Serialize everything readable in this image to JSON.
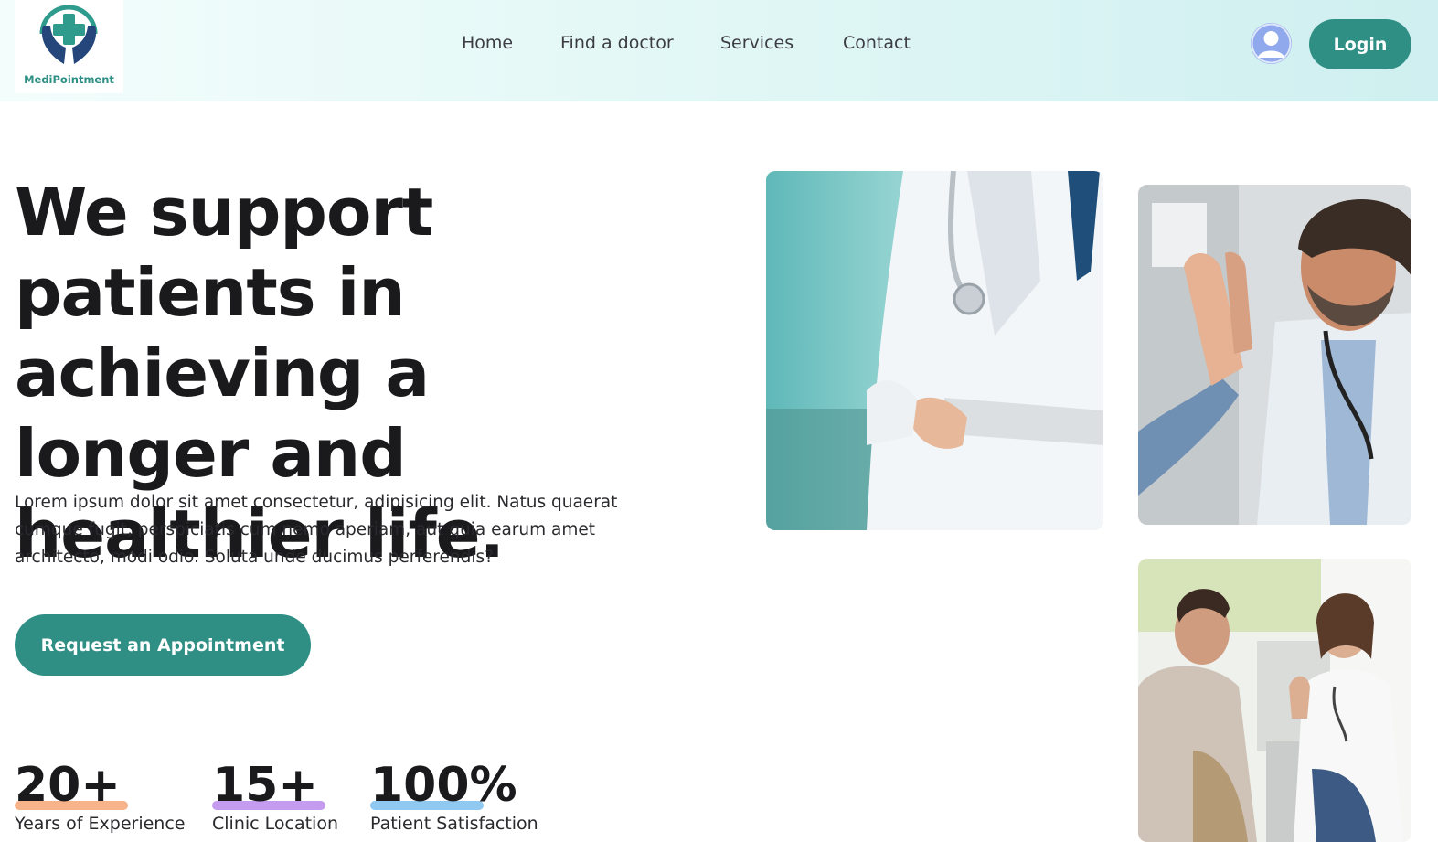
{
  "brand": {
    "name": "MediPointment"
  },
  "nav": {
    "items": [
      {
        "label": "Home"
      },
      {
        "label": "Find a doctor"
      },
      {
        "label": "Services"
      },
      {
        "label": "Contact"
      }
    ],
    "login_label": "Login"
  },
  "hero": {
    "title": "We support patients in achieving a longer and healthier life.",
    "description": "Lorem ipsum dolor sit amet consectetur, adipisicing elit. Natus quaerat cumque fugit, perspiciatis cum nemo aperiam, aut quia earum amet architecto, modi odio. Soluta unde ducimus perferendis?",
    "cta_label": "Request an Appointment"
  },
  "stats": [
    {
      "value": "20+",
      "label": "Years of Experience",
      "accent": "#f7b48a"
    },
    {
      "value": "15+",
      "label": "Clinic Location",
      "accent": "#c59bef"
    },
    {
      "value": "100%",
      "label": "Patient Satisfaction",
      "accent": "#8fc9f2"
    }
  ],
  "colors": {
    "primary": "#2f8f84",
    "avatar": "#8fa9ec"
  },
  "icons": {
    "logo": "medical-cross-hands-icon",
    "user": "user-avatar-icon"
  }
}
